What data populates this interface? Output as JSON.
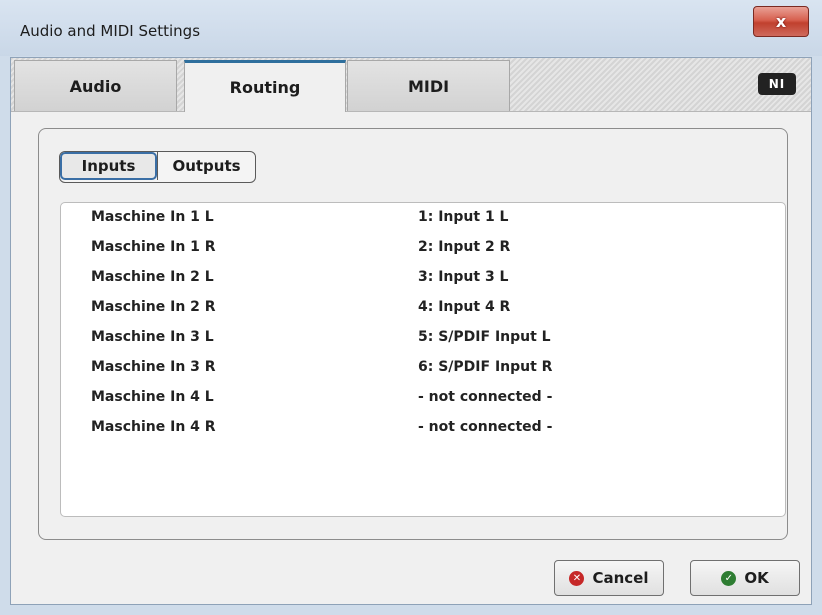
{
  "window": {
    "title": "Audio and MIDI Settings",
    "close_label": "x"
  },
  "tabs": [
    {
      "label": "Audio",
      "active": false
    },
    {
      "label": "Routing",
      "active": true
    },
    {
      "label": "MIDI",
      "active": false
    }
  ],
  "logo": {
    "text": "NI",
    "icon": "ni-logo-icon"
  },
  "segmented": {
    "inputs_label": "Inputs",
    "outputs_label": "Outputs",
    "selected": "Inputs"
  },
  "routes": [
    {
      "name": "Maschine In 1 L",
      "source": "1: Input 1 L"
    },
    {
      "name": "Maschine In 1 R",
      "source": "2: Input 2 R"
    },
    {
      "name": "Maschine In 2 L",
      "source": "3: Input 3 L"
    },
    {
      "name": "Maschine In 2 R",
      "source": "4: Input 4 R"
    },
    {
      "name": "Maschine In 3 L",
      "source": "5: S/PDIF Input L"
    },
    {
      "name": "Maschine In 3 R",
      "source": "6: S/PDIF Input R"
    },
    {
      "name": "Maschine In 4 L",
      "source": "- not connected -"
    },
    {
      "name": "Maschine In 4 R",
      "source": "- not connected -"
    }
  ],
  "footer": {
    "cancel_label": "Cancel",
    "ok_label": "OK",
    "cancel_icon": "cancel-icon",
    "ok_icon": "check-icon"
  },
  "colors": {
    "active_tab_accent": "#2e6f9d",
    "close_button": "#c0402e",
    "cancel_icon": "#c62828",
    "ok_icon": "#2e7d32"
  }
}
